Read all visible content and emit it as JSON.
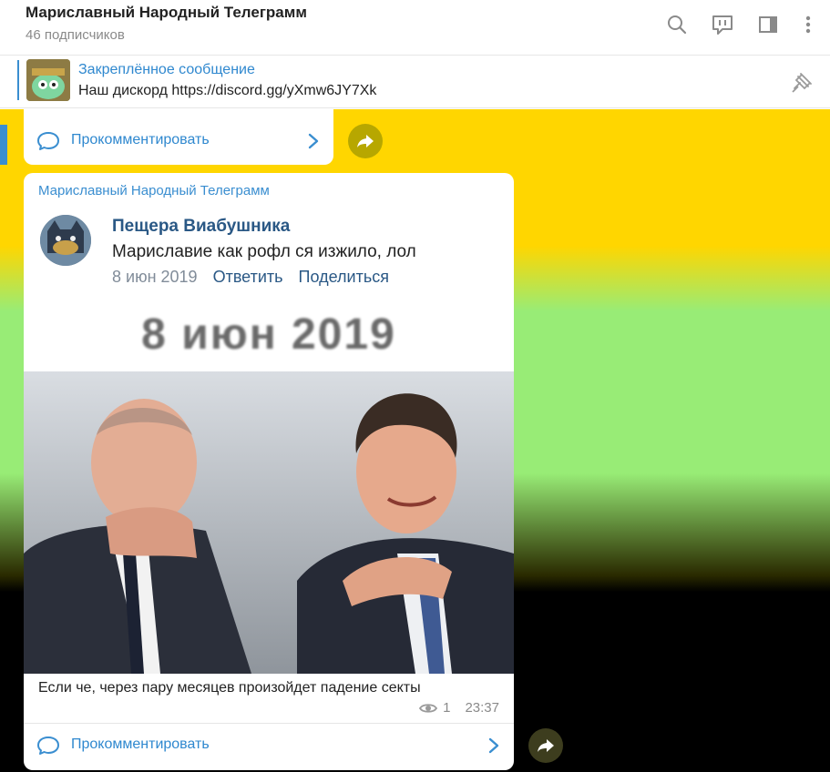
{
  "header": {
    "title": "Мариславный Народный Телеграмм",
    "subtitle": "46 подписчиков",
    "icons": [
      "search-icon",
      "comments-icon",
      "sidebar-icon",
      "more-icon"
    ]
  },
  "pinned": {
    "title": "Закреплённое сообщение",
    "text": "Наш дискорд https://discord.gg/yXmw6JY7Xk"
  },
  "previous_post": {
    "comment_label": "Прокомментировать"
  },
  "post": {
    "author": "Мариславный Народный Телеграмм",
    "screenshot": {
      "name": "Пещера Виабушника",
      "text": "Мариславие как рофл ся изжило, лол",
      "date": "8 июн 2019",
      "reply": "Ответить",
      "share": "Поделиться",
      "big_date": "8 июн 2019"
    },
    "caption": "Если че, через пару месяцев произойдет падение секты",
    "views": "1",
    "time": "23:37",
    "comment_label": "Прокомментировать"
  },
  "colors": {
    "accent": "#3a8ed0",
    "chat_bg_top": "#ffd600",
    "chat_bg_mid": "#98ec76",
    "chat_bg_bottom": "#000000"
  }
}
